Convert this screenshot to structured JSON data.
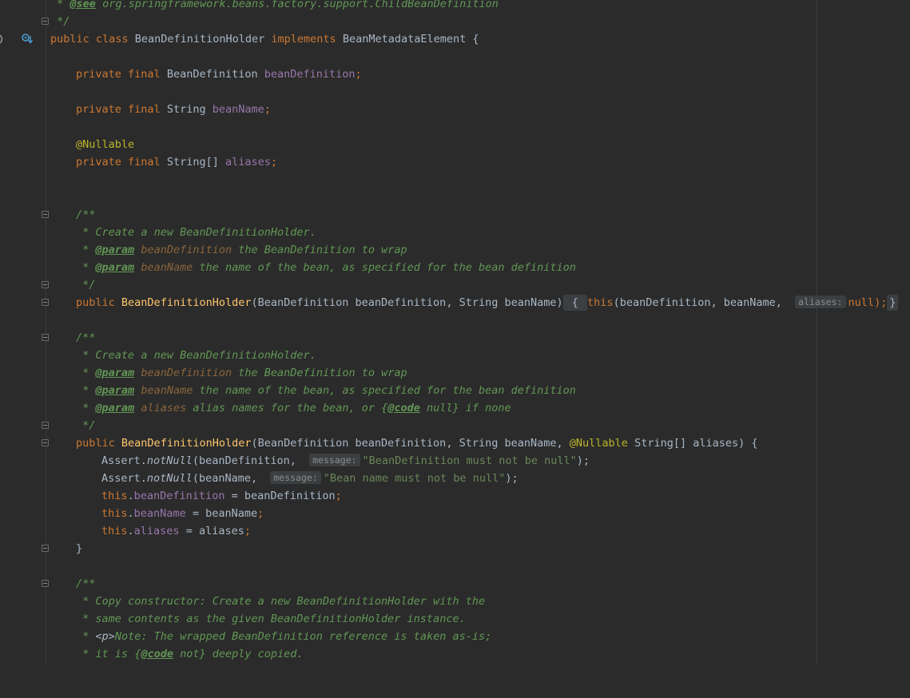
{
  "editor": {
    "gutter_icons": {
      "implements_marker": "implemented-interface-icon",
      "override_marker": "method-marker-icon"
    },
    "lines": {
      "see_tag": "@see",
      "see_target": "org.springframework.beans.factory.support.ChildBeanDefinition",
      "comment_open": "/**",
      "comment_close": "*/",
      "comment_star": "*",
      "class_kw1": "public",
      "class_kw2": "class",
      "class_name": "BeanDefinitionHolder",
      "implements_kw": "implements",
      "interface_name": "BeanMetadataElement",
      "open_brace": "{",
      "close_brace": "}",
      "field1_mods": "private final",
      "field1_type": "BeanDefinition",
      "field1_name": "beanDefinition",
      "field2_mods": "private final",
      "field2_type": "String",
      "field2_name": "beanName",
      "nullable": "@Nullable",
      "field3_mods": "private final",
      "field3_type": "String[]",
      "field3_name": "aliases",
      "semicolon": ";"
    },
    "doc1": {
      "desc": "Create a new BeanDefinitionHolder.",
      "param_tag": "@param",
      "p1_name": "beanDefinition",
      "p1_desc": "the BeanDefinition to wrap",
      "p2_name": "beanName",
      "p2_desc": "the name of the bean, as specified for the bean definition"
    },
    "ctor1": {
      "mod": "public",
      "name": "BeanDefinitionHolder",
      "params": "(BeanDefinition beanDefinition, String beanName)",
      "body_open": "{",
      "this_kw": "this",
      "call_args": "(beanDefinition, beanName,",
      "hint": "aliases:",
      "null_kw": "null",
      "call_end": ");",
      "body_close": "}"
    },
    "doc2": {
      "desc": "Create a new BeanDefinitionHolder.",
      "param_tag": "@param",
      "p1_name": "beanDefinition",
      "p1_desc": "the BeanDefinition to wrap",
      "p2_name": "beanName",
      "p2_desc": "the name of the bean, as specified for the bean definition",
      "p3_name": "aliases",
      "p3_desc_a": "alias names for the bean, or {",
      "code_tag": "@code",
      "p3_desc_b": "null} if none"
    },
    "ctor2": {
      "mod": "public",
      "name": "BeanDefinitionHolder",
      "params_a": "(BeanDefinition beanDefinition, String beanName,",
      "nullable": "@Nullable",
      "params_b": "String[] aliases) {",
      "assert1_obj": "Assert.",
      "assert_method": "notNull",
      "assert1_arg": "(beanDefinition,",
      "hint": "message:",
      "assert1_msg": "\"BeanDefinition must not be null\"",
      "assert2_arg": "(beanName,",
      "assert2_msg": "\"Bean name must not be null\"",
      "call_end": ");",
      "this_kw": "this",
      "dot": ".",
      "assign1_field": "beanDefinition",
      "assign1_rhs": " = beanDefinition",
      "assign2_field": "beanName",
      "assign2_rhs": " = beanName",
      "assign3_field": "aliases",
      "assign3_rhs": " = aliases",
      "close": "}"
    },
    "doc3": {
      "line1": "Copy constructor: Create a new BeanDefinitionHolder with the",
      "line2": "same contents as the given BeanDefinitionHolder instance.",
      "p_tag": "<p>",
      "line3": "Note: The wrapped BeanDefinition reference is taken as-is;",
      "line4_a": "it is {",
      "code_tag": "@code",
      "line4_b": " not} deeply copied."
    }
  }
}
